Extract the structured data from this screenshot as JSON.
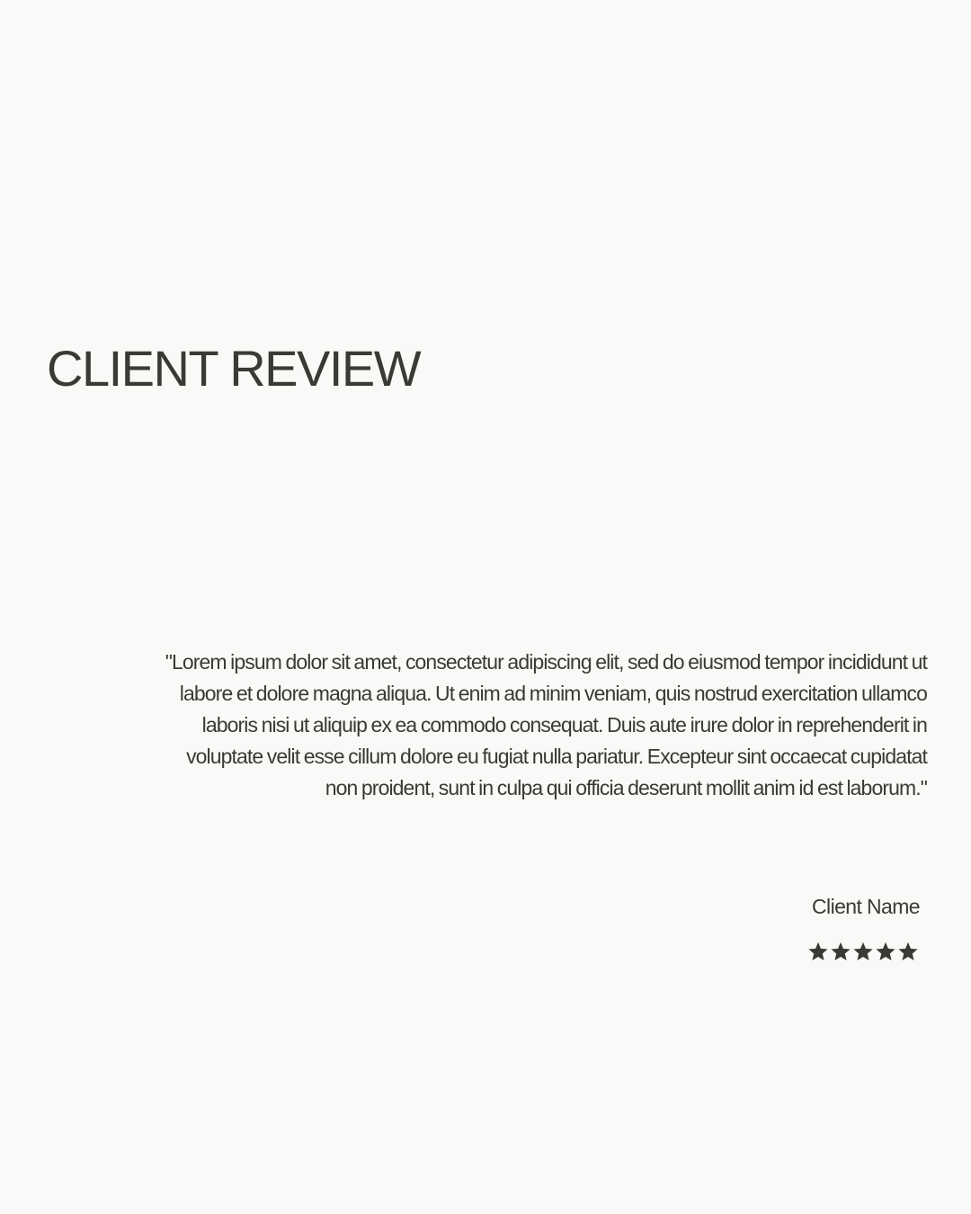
{
  "theme": {
    "background": "#FAF9F7",
    "text": "#3A3A35"
  },
  "review": {
    "heading": "CLIENT REVIEW",
    "quote": "\"Lorem ipsum dolor sit amet, consectetur adipiscing elit, sed do eiusmod tempor incididunt ut labore et dolore magna aliqua. Ut enim ad minim veniam, quis nostrud exercitation ullamco laboris nisi ut aliquip ex ea commodo consequat. Duis aute irure dolor in reprehenderit in voluptate velit esse cillum dolore eu fugiat nulla pariatur. Excepteur sint occaecat cupidatat non proident, sunt in culpa qui officia deserunt mollit anim id est laborum.\"",
    "client_name": "Client Name",
    "rating": 5,
    "rating_max": 5,
    "star_icon": "star-icon"
  }
}
